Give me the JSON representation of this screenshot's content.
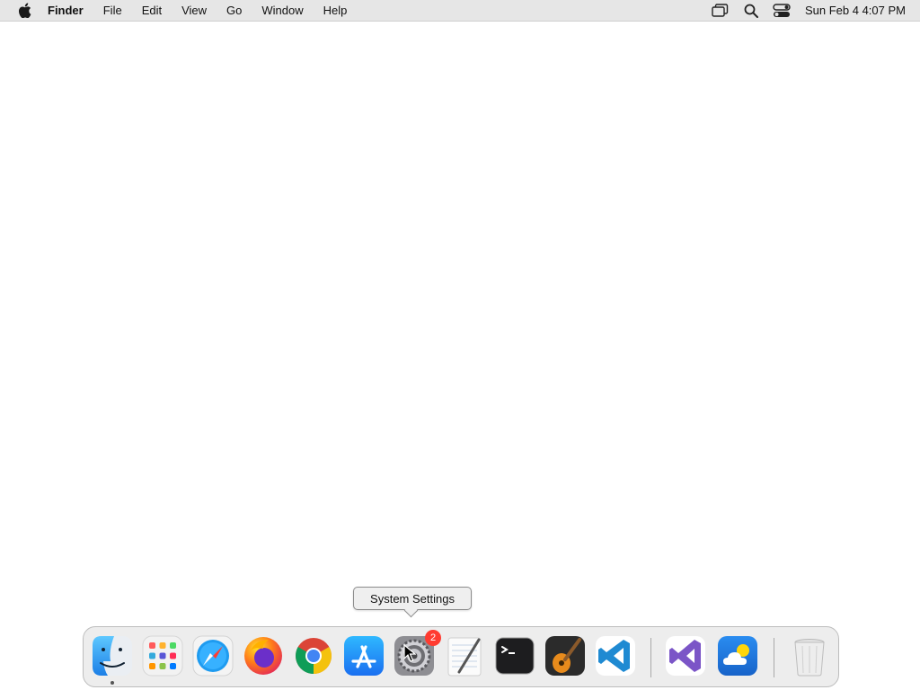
{
  "menubar": {
    "app_name": "Finder",
    "items": [
      "File",
      "Edit",
      "View",
      "Go",
      "Window",
      "Help"
    ],
    "status_icons": [
      "screen-mirroring-icon",
      "spotlight-search-icon",
      "control-center-icon"
    ],
    "clock": "Sun Feb 4  4:07 PM"
  },
  "tooltip": {
    "text": "System Settings"
  },
  "dock": {
    "items": [
      {
        "name": "Finder",
        "icon": "finder-icon",
        "running": true
      },
      {
        "name": "Launchpad",
        "icon": "launchpad-icon"
      },
      {
        "name": "Safari",
        "icon": "safari-icon"
      },
      {
        "name": "Firefox",
        "icon": "firefox-icon"
      },
      {
        "name": "Google Chrome",
        "icon": "chrome-icon"
      },
      {
        "name": "App Store",
        "icon": "app-store-icon"
      },
      {
        "name": "System Settings",
        "icon": "system-settings-icon",
        "badge": "2"
      },
      {
        "name": "TextEdit",
        "icon": "textedit-icon"
      },
      {
        "name": "Terminal",
        "icon": "terminal-icon"
      },
      {
        "name": "GarageBand",
        "icon": "garageband-icon"
      },
      {
        "name": "Visual Studio Code",
        "icon": "vscode-icon"
      },
      {
        "name": "Visual Studio",
        "icon": "visual-studio-icon"
      },
      {
        "name": "Weather",
        "icon": "weather-icon"
      },
      {
        "name": "Trash",
        "icon": "trash-icon"
      }
    ]
  },
  "colors": {
    "menubar_bg": "#e6e6e6",
    "badge": "#ff3b30",
    "app_store_blue": "#1a8cff",
    "vscode_blue": "#1f8ad2",
    "visual_studio_purple": "#7b55c7"
  }
}
